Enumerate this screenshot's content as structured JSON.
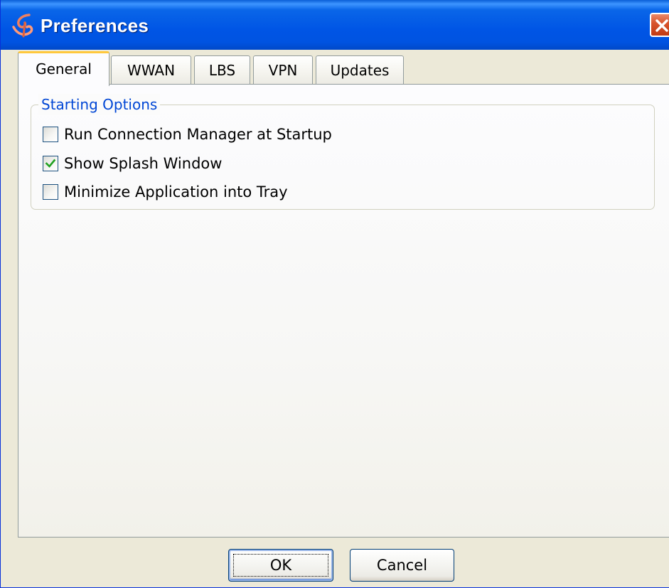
{
  "window": {
    "title": "Preferences",
    "app_icon": "app-logo-icon",
    "close_icon": "close-icon"
  },
  "tabs": [
    {
      "label": "General",
      "active": true
    },
    {
      "label": "WWAN",
      "active": false
    },
    {
      "label": "LBS",
      "active": false
    },
    {
      "label": "VPN",
      "active": false
    },
    {
      "label": "Updates",
      "active": false
    }
  ],
  "general": {
    "group_title": "Starting Options",
    "options": [
      {
        "label": "Run Connection Manager at Startup",
        "checked": false
      },
      {
        "label": "Show Splash Window",
        "checked": true
      },
      {
        "label": "Minimize Application into Tray",
        "checked": false
      }
    ]
  },
  "buttons": {
    "ok_label": "OK",
    "cancel_label": "Cancel"
  },
  "colors": {
    "titlebar_blue": "#0055e5",
    "active_tab_accent": "#ffc83c",
    "group_title_blue": "#0046d5",
    "check_green": "#21a121",
    "close_red": "#c13a12"
  }
}
